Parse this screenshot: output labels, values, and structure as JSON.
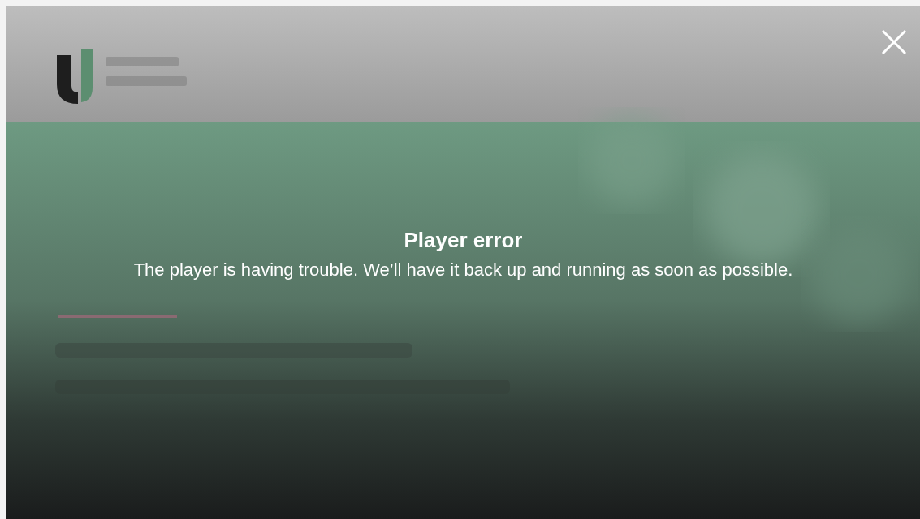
{
  "error": {
    "title": "Player error",
    "message": "The player is having trouble. We’ll have it back up and running as soon as possible."
  }
}
